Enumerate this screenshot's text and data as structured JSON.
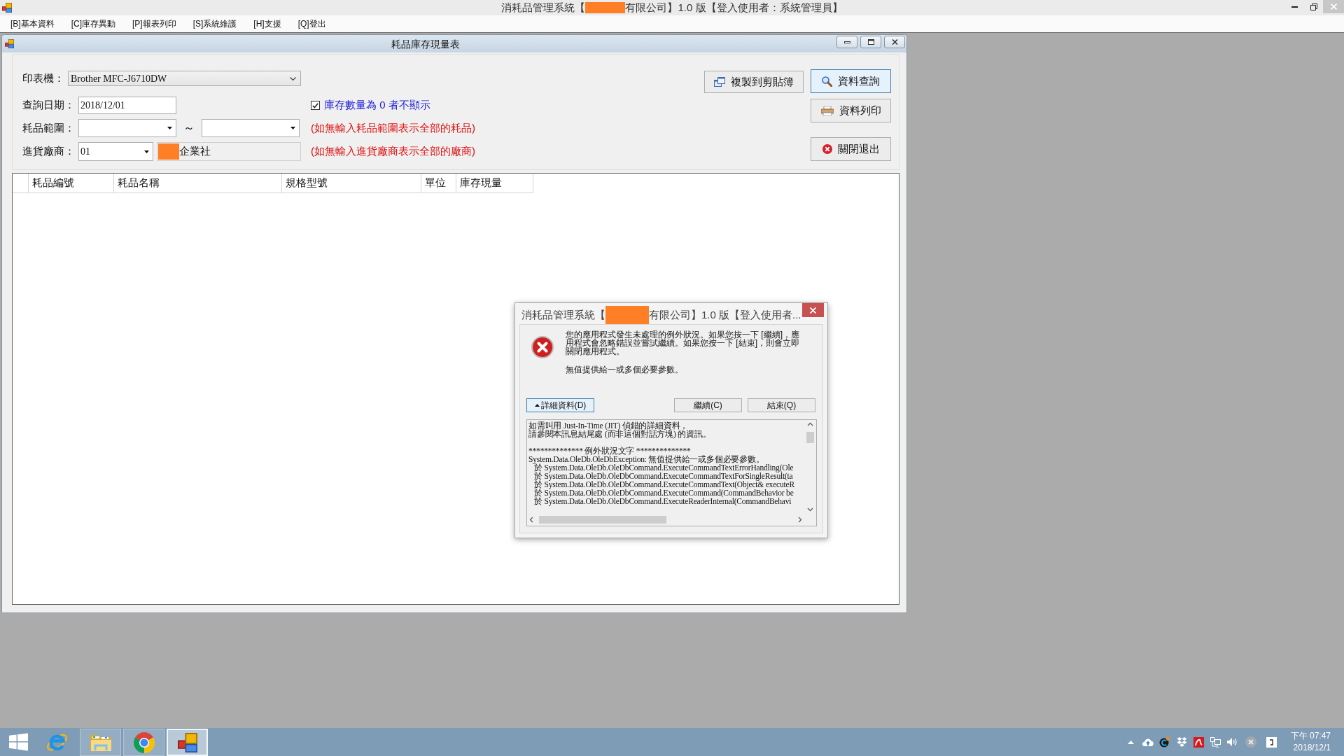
{
  "window": {
    "title_start": "消耗品管理系統【",
    "title_end": "有限公司】1.0 版【登入使用者：系統管理員】"
  },
  "menu": [
    {
      "label": "[B]基本資料"
    },
    {
      "label": "[C]庫存異動"
    },
    {
      "label": "[P]報表列印"
    },
    {
      "label": "[S]系統維護"
    },
    {
      "label": "[H]支援"
    },
    {
      "label": "[Q]登出"
    }
  ],
  "child_window": {
    "title": "耗品庫存現量表"
  },
  "form": {
    "printer": {
      "label": "印表機：",
      "value": "Brother MFC-J6710DW"
    },
    "query_date": {
      "label": "查詢日期：",
      "value": "2018/12/01"
    },
    "hide_zero": {
      "label": "庫存數量為 0 者不顯示",
      "checked": true
    },
    "item_range": {
      "label": "耗品範圍：",
      "separator": "～",
      "note": "(如無輸入耗品範圍表示全部的耗品)"
    },
    "supplier": {
      "label": "進貨廠商：",
      "code": "01",
      "name": "企業社",
      "note": "(如無輸入進貨廠商表示全部的廠商)"
    }
  },
  "buttons": [
    {
      "kind": "copy",
      "label": "複製到剪貼簿",
      "focused": false
    },
    {
      "kind": "search",
      "label": "資料查詢",
      "focused": true
    },
    {
      "kind": "print",
      "label": "資料列印",
      "focused": false
    },
    {
      "kind": "exit",
      "label": "關閉退出",
      "focused": false
    }
  ],
  "grid": {
    "columns": [
      "耗品編號",
      "耗品名稱",
      "規格型號",
      "單位",
      "庫存現量"
    ]
  },
  "dialog": {
    "title_start": "消耗品管理系統【",
    "title_end": "有限公司】1.0 版【登入使用者...",
    "message": "您的應用程式發生未處理的例外狀況。如果您按一下 [繼續]，應用程式會忽略錯誤並嘗試繼續。如果您按一下 [結束]，則會立即關閉應用程式。",
    "error": "無值提供給一或多個必要參數。",
    "buttons": [
      {
        "kind": "details",
        "label": "詳細資料(D)",
        "focused": true,
        "expanded": true
      },
      {
        "kind": "plain",
        "label": "繼續(C)",
        "focused": false
      },
      {
        "kind": "plain",
        "label": "結束(Q)",
        "focused": false
      }
    ],
    "details": [
      {
        "lines": [
          {
            "text": "如需叫用 Just-In-Time (JIT) 偵錯的詳細資料，",
            "indented": false
          },
          {
            "text": "請參閱本訊息結尾處 (而非這個對話方塊) 的資訊。",
            "indented": false
          }
        ]
      },
      {
        "lines": [
          {
            "text": "************** 例外狀況文字 **************",
            "indented": false
          },
          {
            "text": "System.Data.OleDb.OleDbException: 無值提供給一或多個必要參數。",
            "indented": false
          },
          {
            "text": "於 System.Data.OleDb.OleDbCommand.ExecuteCommandTextErrorHandling(Ole",
            "indented": true
          },
          {
            "text": "於 System.Data.OleDb.OleDbCommand.ExecuteCommandTextForSingleResult(ta",
            "indented": true
          },
          {
            "text": "於 System.Data.OleDb.OleDbCommand.ExecuteCommandText(Object& executeR",
            "indented": true
          },
          {
            "text": "於 System.Data.OleDb.OleDbCommand.ExecuteCommand(CommandBehavior be",
            "indented": true
          },
          {
            "text": "於 System.Data.OleDb.OleDbCommand.ExecuteReaderInternal(CommandBehavi",
            "indented": true
          }
        ]
      }
    ]
  },
  "taskbar": {
    "apps": [
      {
        "kind": "browser_e",
        "running": false,
        "selected": false
      },
      {
        "kind": "folder",
        "running": true,
        "selected": false
      },
      {
        "kind": "browser_ring",
        "running": true,
        "selected": false
      },
      {
        "kind": "squares",
        "running": true,
        "selected": true
      }
    ],
    "clock": {
      "time": "下午 07:47",
      "date": "2018/12/1"
    }
  }
}
